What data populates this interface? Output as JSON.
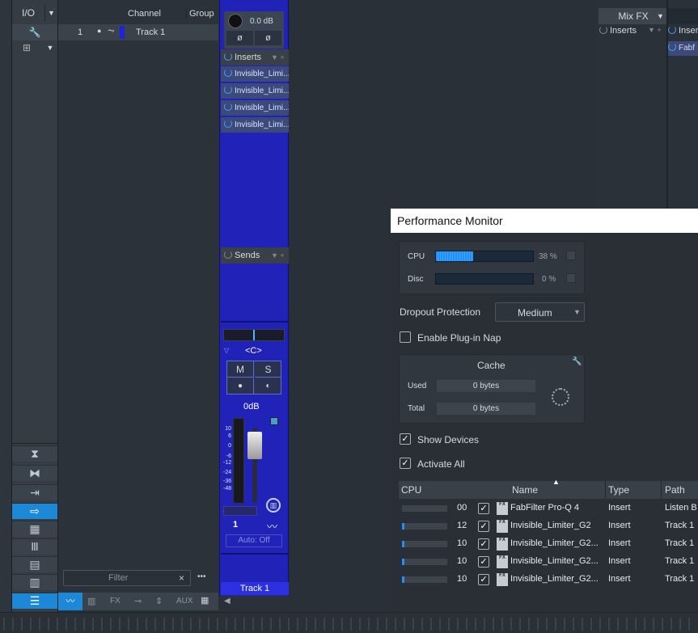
{
  "io_column": {
    "io_label": "I/O",
    "wrench_icon": "wrench-icon",
    "view_buttons": [
      "fold-icon",
      "expand-icon",
      "pin-icon",
      "route-icon",
      "keyboard-icon",
      "piano-icon",
      "stack-icon",
      "bars-icon",
      "list-icon"
    ]
  },
  "channel_list": {
    "header_channel": "Channel",
    "header_group": "Group",
    "row_number": "1",
    "row_name": "Track 1"
  },
  "filter": {
    "placeholder": "Filter",
    "clear": "×",
    "more": "•••"
  },
  "bottom_tabs": [
    "FX",
    "AUX"
  ],
  "strip": {
    "gain": "0.0 dB",
    "phase_a": "ø",
    "phase_b": "ø",
    "inserts_label": "Inserts",
    "inserts": [
      "Invisible_Limi...",
      "Invisible_Limi...",
      "Invisible_Limi...",
      "Invisible_Limi..."
    ],
    "sends_label": "Sends",
    "pan": "<C>",
    "mute": "M",
    "solo": "S",
    "fader_value": "0dB",
    "scale": [
      "10",
      "6",
      "0",
      "-6",
      "-12",
      "-24",
      "-36",
      "-48"
    ],
    "channel_number": "1",
    "automation": "Auto: Off",
    "name": "Track 1"
  },
  "mixfx": {
    "title": "Mix FX",
    "inserts_label": "Inserts",
    "insert_item": "Fabf"
  },
  "perf": {
    "title": "Performance Monitor",
    "cpu_label": "CPU",
    "cpu_value": "38 %",
    "cpu_pct": 38,
    "disc_label": "Disc",
    "disc_value": "0 %",
    "disc_pct": 0,
    "dropout_label": "Dropout Protection",
    "dropout_value": "Medium",
    "plugin_nap": "Enable Plug-in Nap",
    "cache_title": "Cache",
    "used_label": "Used",
    "used_value": "0 bytes",
    "total_label": "Total",
    "total_value": "0 bytes",
    "show_devices": "Show Devices",
    "activate_all": "Activate All",
    "columns": [
      "CPU",
      "Name",
      "Type",
      "Path"
    ],
    "rows": [
      {
        "cpu": "00",
        "name": "FabFilter Pro-Q 4",
        "type": "Insert",
        "path": "Listen B",
        "fx": "FX",
        "cpu_fill": 0
      },
      {
        "cpu": "12",
        "name": "Invisible_Limiter_G2",
        "type": "Insert",
        "path": "Track 1",
        "fx": "FX",
        "cpu_fill": 0.12
      },
      {
        "cpu": "10",
        "name": "Invisible_Limiter_G2...",
        "type": "Insert",
        "path": "Track 1",
        "fx": "FX",
        "cpu_fill": 0.1
      },
      {
        "cpu": "10",
        "name": "Invisible_Limiter_G2...",
        "type": "Insert",
        "path": "Track 1",
        "fx": "FX",
        "cpu_fill": 0.1
      },
      {
        "cpu": "10",
        "name": "Invisible_Limiter_G2...",
        "type": "Insert",
        "path": "Track 1",
        "fx": "FX",
        "cpu_fill": 0.1
      }
    ]
  },
  "colors": {
    "accent": "#1e88d8",
    "strip": "#2022b8",
    "meter": "#1e90ff"
  }
}
